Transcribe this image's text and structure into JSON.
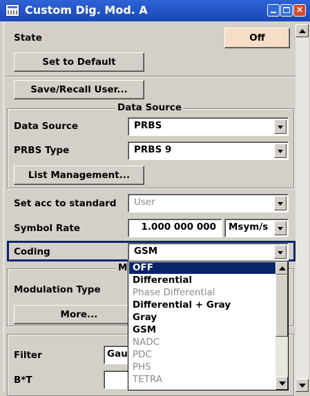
{
  "window": {
    "title": "Custom Dig. Mod. A",
    "close_glyph": "×"
  },
  "state": {
    "label": "State",
    "value": "Off"
  },
  "buttons": {
    "set_default": "Set to Default",
    "save_recall": "Save/Recall User...",
    "list_management": "List Management...",
    "more": "More..."
  },
  "data_source_group": {
    "title": "Data Source",
    "data_source_label": "Data Source",
    "data_source_value": "PRBS",
    "prbs_type_label": "PRBS Type",
    "prbs_type_value": "PRBS 9"
  },
  "standard": {
    "label": "Set acc to standard",
    "value": "User"
  },
  "symbol_rate": {
    "label": "Symbol Rate",
    "value": "1.000 000 000",
    "unit": "Msym/s"
  },
  "coding": {
    "label": "Coding",
    "value": "GSM",
    "options": [
      {
        "label": "OFF",
        "state": "selected"
      },
      {
        "label": "Differential",
        "state": "enabled"
      },
      {
        "label": "Phase Differential",
        "state": "disabled"
      },
      {
        "label": "Differential + Gray",
        "state": "enabled"
      },
      {
        "label": "Gray",
        "state": "enabled"
      },
      {
        "label": "GSM",
        "state": "enabled"
      },
      {
        "label": "NADC",
        "state": "disabled"
      },
      {
        "label": "PDC",
        "state": "disabled"
      },
      {
        "label": "PHS",
        "state": "disabled"
      },
      {
        "label": "TETRA",
        "state": "disabled"
      }
    ]
  },
  "modulation_group": {
    "title_partial": "M",
    "modulation_type_label": "Modulation Type"
  },
  "filter_group": {
    "filter_label": "Filter",
    "filter_value_partial": "Gau",
    "bt_label": "B*T"
  },
  "colors": {
    "titlebar": "#2f63d6",
    "selection": "#0a246a",
    "focus_border": "#0a246a",
    "state_off_button": "#f7ddc6",
    "close_button": "#d9482b"
  },
  "icons": [
    "app-window-icon",
    "minimize-icon",
    "maximize-icon",
    "close-icon",
    "dropdown-arrow-icon",
    "scroll-up-icon",
    "scroll-down-icon"
  ]
}
